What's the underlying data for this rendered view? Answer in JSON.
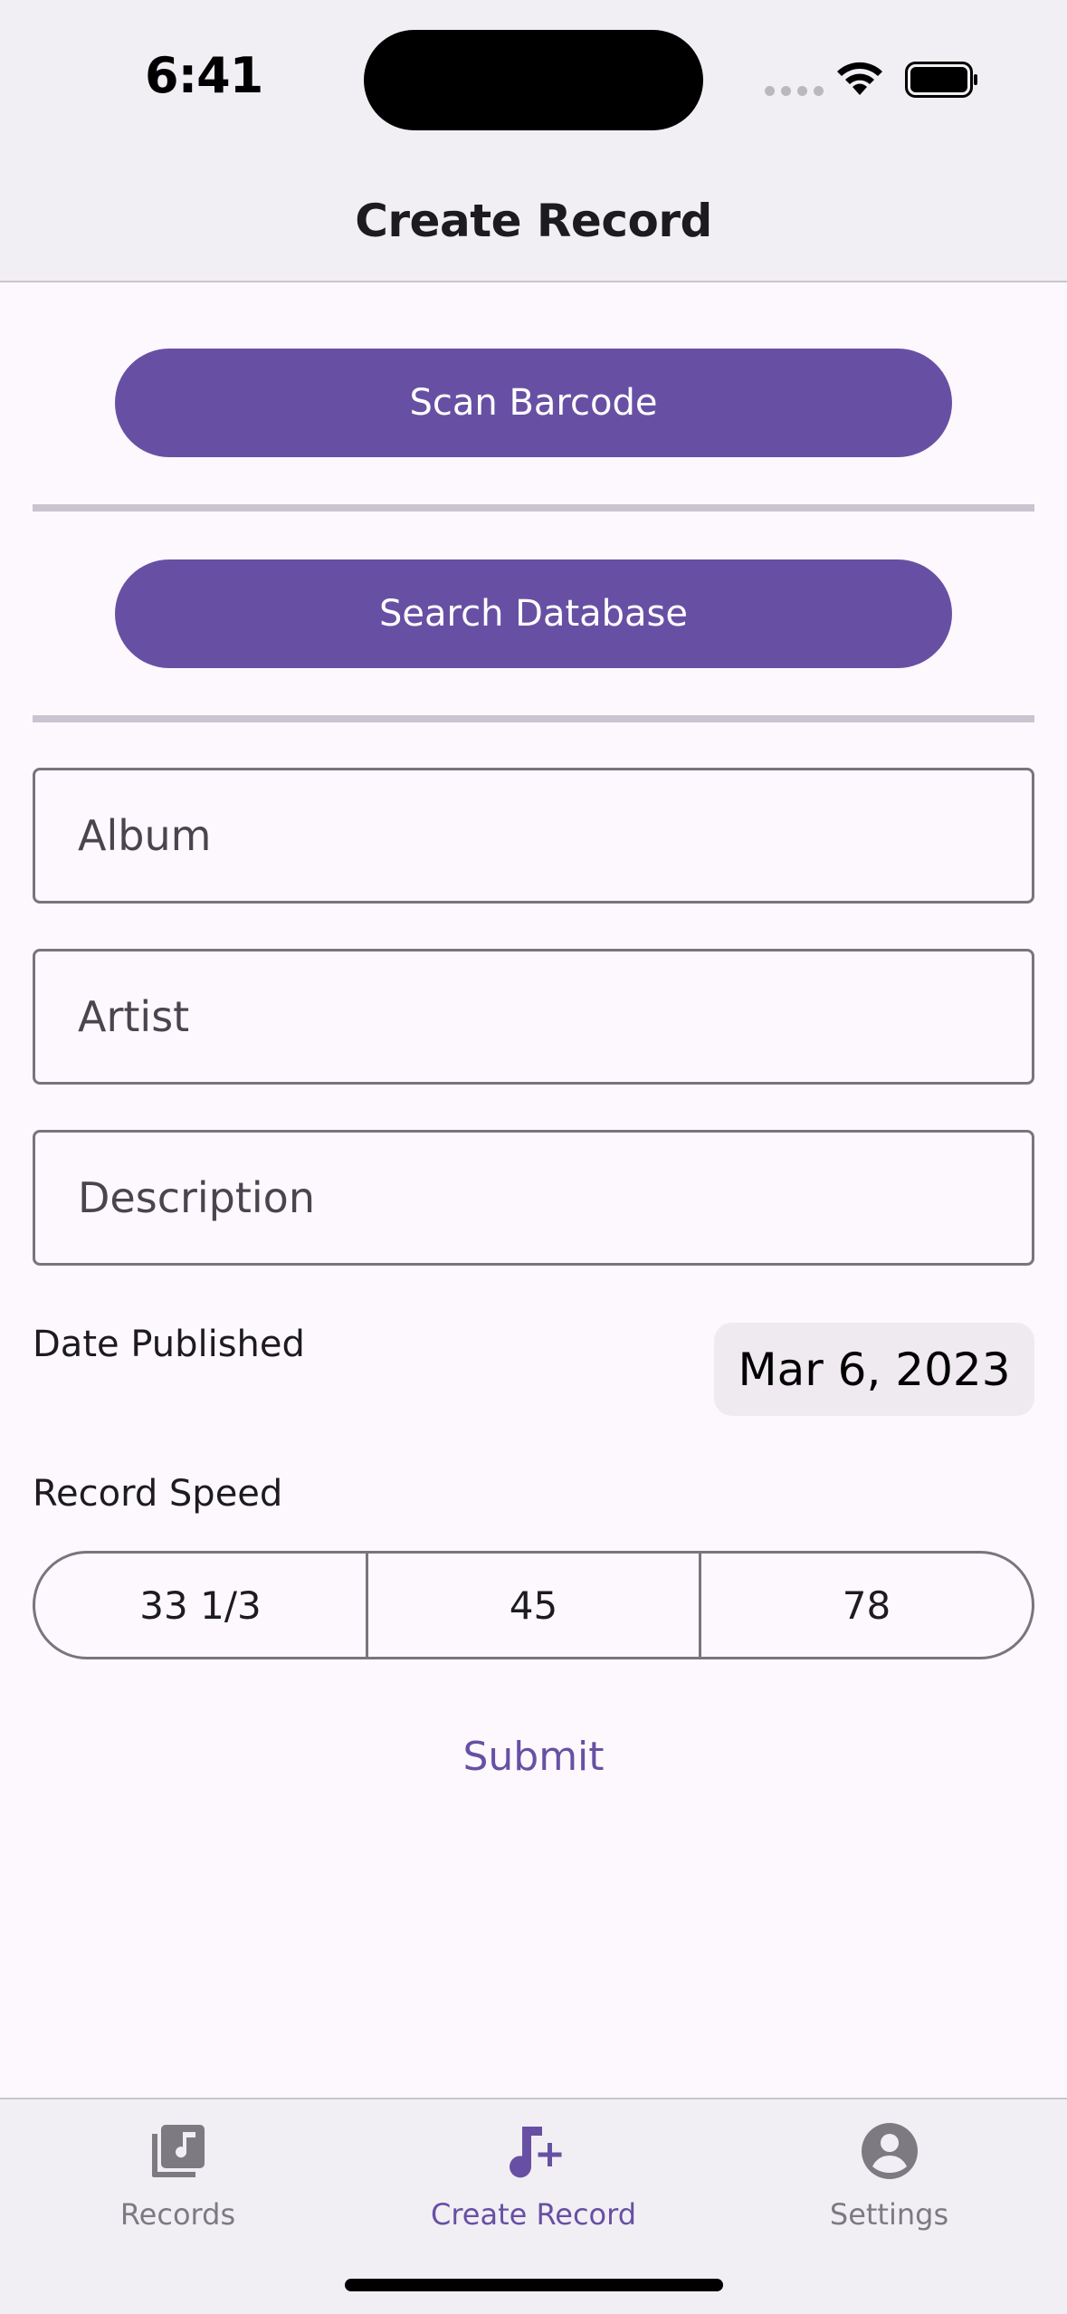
{
  "status_bar": {
    "time": "6:41"
  },
  "header": {
    "title": "Create Record"
  },
  "actions": {
    "scan_label": "Scan Barcode",
    "search_label": "Search Database"
  },
  "form": {
    "album_placeholder": "Album",
    "artist_placeholder": "Artist",
    "description_placeholder": "Description",
    "date_label": "Date Published",
    "date_value": "Mar 6, 2023",
    "speed_label": "Record Speed",
    "speeds": [
      "33 1/3",
      "45",
      "78"
    ],
    "submit_label": "Submit"
  },
  "tabs": [
    {
      "label": "Records",
      "icon": "music-library-icon",
      "active": false
    },
    {
      "label": "Create Record",
      "icon": "music-note-add-icon",
      "active": true
    },
    {
      "label": "Settings",
      "icon": "account-circle-icon",
      "active": false
    }
  ],
  "colors": {
    "accent": "#6750a4",
    "inactive": "#7d7a82",
    "bar_bg": "#f2eff4"
  }
}
